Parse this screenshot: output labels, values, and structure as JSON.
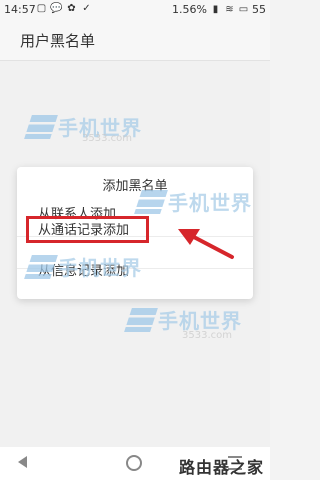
{
  "status_bar": {
    "time": "14:57",
    "battery_percent": "1.56%",
    "battery_level": "55",
    "icons": [
      "sim-icon",
      "chat-icon",
      "paw-icon",
      "check-icon",
      "signal-icon",
      "wifi-icon",
      "battery-icon"
    ]
  },
  "app_bar": {
    "title": "用户黑名单"
  },
  "dialog": {
    "title": "添加黑名单",
    "items": [
      {
        "label": "从联系人添加"
      },
      {
        "label": "从通话记录添加"
      },
      {
        "label": "从信息记录添加"
      }
    ]
  },
  "watermark": {
    "big": "手机世界",
    "small": "3533.com"
  },
  "logo": {
    "text": "路由器之家"
  },
  "colors": {
    "highlight": "#d6262b",
    "watermark": "#a9cde8"
  }
}
